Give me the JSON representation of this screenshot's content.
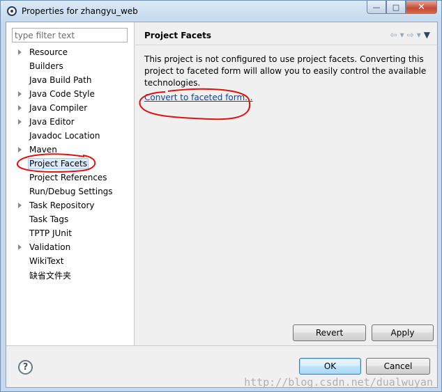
{
  "window": {
    "title": "Properties for zhangyu_web",
    "min_glyph": "—",
    "max_glyph": "□",
    "close_glyph": "✕"
  },
  "filter": {
    "placeholder": "type filter text",
    "value": ""
  },
  "tree": [
    {
      "label": "Resource",
      "expandable": true
    },
    {
      "label": "Builders",
      "expandable": false
    },
    {
      "label": "Java Build Path",
      "expandable": false
    },
    {
      "label": "Java Code Style",
      "expandable": true
    },
    {
      "label": "Java Compiler",
      "expandable": true
    },
    {
      "label": "Java Editor",
      "expandable": true
    },
    {
      "label": "Javadoc Location",
      "expandable": false
    },
    {
      "label": "Maven",
      "expandable": true
    },
    {
      "label": "Project Facets",
      "expandable": false,
      "selected": true
    },
    {
      "label": "Project References",
      "expandable": false
    },
    {
      "label": "Run/Debug Settings",
      "expandable": false
    },
    {
      "label": "Task Repository",
      "expandable": true
    },
    {
      "label": "Task Tags",
      "expandable": false
    },
    {
      "label": "TPTP JUnit",
      "expandable": false
    },
    {
      "label": "Validation",
      "expandable": true
    },
    {
      "label": "WikiText",
      "expandable": false
    },
    {
      "label": "缺省文件夹",
      "expandable": false
    }
  ],
  "page": {
    "title": "Project Facets",
    "description": "This project is not configured to use project facets. Converting this project to faceted form will allow you to easily control the available technologies.",
    "convert_link": "Convert to faceted form..."
  },
  "nav_icons": [
    "back-arrow-icon",
    "back-dropdown-icon",
    "forward-arrow-icon",
    "forward-dropdown-icon",
    "view-menu-icon"
  ],
  "buttons": {
    "revert": "Revert",
    "apply": "Apply",
    "ok": "OK",
    "cancel": "Cancel",
    "help": "?"
  },
  "watermark": "http://blog.csdn.net/dualwuyan",
  "colors": {
    "annotation": "#e01010",
    "link": "#0645ad"
  }
}
